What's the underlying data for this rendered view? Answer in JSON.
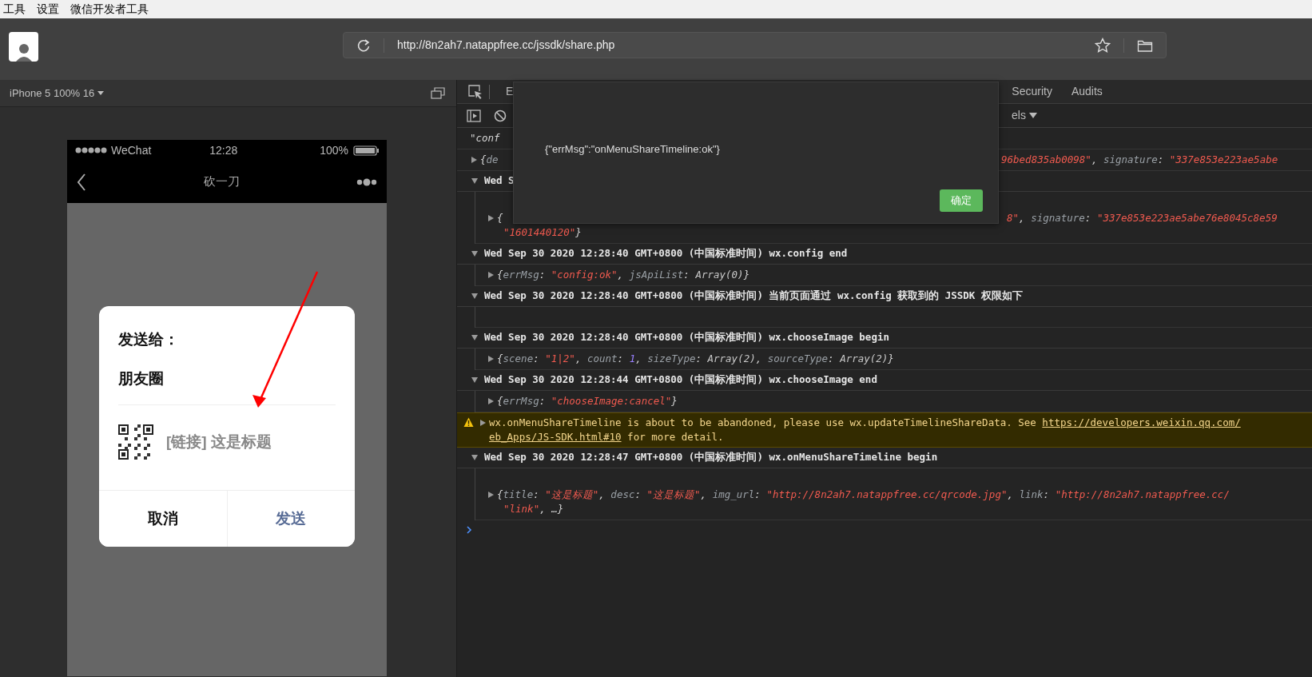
{
  "menu_bar": {
    "items": [
      "工具",
      "设置",
      "微信开发者工具"
    ]
  },
  "toolbar": {
    "url": "http://8n2ah7.natappfree.cc/jssdk/share.php"
  },
  "simulator": {
    "device_label": "iPhone 5 100% 16",
    "status_bar": {
      "carrier": "WeChat",
      "time": "12:28",
      "battery": "100%"
    },
    "nav_bar": {
      "title": "砍一刀"
    },
    "share_dialog": {
      "heading": "发送给：",
      "target": "朋友圈",
      "link_title": "[链接] 这是标题",
      "buttons": [
        {
          "label": "取消",
          "kind": "cancel"
        },
        {
          "label": "发送",
          "kind": "primary"
        }
      ]
    }
  },
  "devtools": {
    "tabs": [
      {
        "label": "E",
        "selected": false
      },
      {
        "label": "Security",
        "selected": false
      },
      {
        "label": "Audits",
        "selected": false
      }
    ],
    "levels_label": "els",
    "console": {
      "rows": [
        {
          "kind": "string",
          "lines": [
            {
              "left": [
                {
                  "kind": "plain",
                  "text": "\"conf"
                }
              ]
            }
          ]
        },
        {
          "kind": "object",
          "expanded": false,
          "lines": [
            {
              "left": [
                {
                  "kind": "plain",
                  "text": "{"
                },
                {
                  "kind": "key",
                  "text": "de"
                }
              ],
              "right": [
                {
                  "kind": "string",
                  "text": "96bed835ab0098\""
                },
                {
                  "kind": "plain",
                  "text": ", "
                },
                {
                  "kind": "key",
                  "text": "signature"
                },
                {
                  "kind": "plain",
                  "text": ": "
                },
                {
                  "kind": "string",
                  "text": "\"337e853e223ae5abe"
                }
              ]
            }
          ]
        },
        {
          "kind": "group",
          "expanded": true,
          "title": "Wed S",
          "children": [
            {
              "kind": "object",
              "expanded": false,
              "lines": [
                {
                  "left": [
                    {
                      "kind": "plain",
                      "text": "{"
                    }
                  ],
                  "right": [
                    {
                      "kind": "string",
                      "text": "8\""
                    },
                    {
                      "kind": "plain",
                      "text": ", "
                    },
                    {
                      "kind": "key",
                      "text": "signature"
                    },
                    {
                      "kind": "plain",
                      "text": ": "
                    },
                    {
                      "kind": "string",
                      "text": "\"337e853e223ae5abe76e8045c8e59"
                    }
                  ]
                },
                {
                  "left": [
                    {
                      "kind": "string",
                      "text": "\"1601440120\""
                    },
                    {
                      "kind": "plain",
                      "text": "}"
                    }
                  ]
                }
              ]
            }
          ]
        },
        {
          "kind": "group",
          "expanded": true,
          "title": "Wed Sep 30 2020 12:28:40 GMT+0800 (中国标准时间) wx.config end",
          "children": [
            {
              "kind": "object",
              "expanded": false,
              "lines": [
                {
                  "left": [
                    {
                      "kind": "plain",
                      "text": "{"
                    },
                    {
                      "kind": "key",
                      "text": "errMsg"
                    },
                    {
                      "kind": "plain",
                      "text": ": "
                    },
                    {
                      "kind": "string",
                      "text": "\"config:ok\""
                    },
                    {
                      "kind": "plain",
                      "text": ", "
                    },
                    {
                      "kind": "key",
                      "text": "jsApiList"
                    },
                    {
                      "kind": "plain",
                      "text": ": "
                    },
                    {
                      "kind": "value",
                      "text": "Array(0)"
                    },
                    {
                      "kind": "plain",
                      "text": "}"
                    }
                  ]
                }
              ]
            }
          ]
        },
        {
          "kind": "group",
          "expanded": true,
          "title": "Wed Sep 30 2020 12:28:40 GMT+0800 (中国标准时间) 当前页面通过 wx.config 获取到的 JSSDK 权限如下",
          "children": [
            {
              "kind": "empty"
            }
          ]
        },
        {
          "kind": "group",
          "expanded": true,
          "title": "Wed Sep 30 2020 12:28:40 GMT+0800 (中国标准时间) wx.chooseImage begin",
          "children": [
            {
              "kind": "object",
              "expanded": false,
              "lines": [
                {
                  "left": [
                    {
                      "kind": "plain",
                      "text": "{"
                    },
                    {
                      "kind": "key",
                      "text": "scene"
                    },
                    {
                      "kind": "plain",
                      "text": ": "
                    },
                    {
                      "kind": "string",
                      "text": "\"1|2\""
                    },
                    {
                      "kind": "plain",
                      "text": ", "
                    },
                    {
                      "kind": "key",
                      "text": "count"
                    },
                    {
                      "kind": "plain",
                      "text": ": "
                    },
                    {
                      "kind": "number",
                      "text": "1"
                    },
                    {
                      "kind": "plain",
                      "text": ", "
                    },
                    {
                      "kind": "key",
                      "text": "sizeType"
                    },
                    {
                      "kind": "plain",
                      "text": ": "
                    },
                    {
                      "kind": "value",
                      "text": "Array(2)"
                    },
                    {
                      "kind": "plain",
                      "text": ", "
                    },
                    {
                      "kind": "key",
                      "text": "sourceType"
                    },
                    {
                      "kind": "plain",
                      "text": ": "
                    },
                    {
                      "kind": "value",
                      "text": "Array(2)"
                    },
                    {
                      "kind": "plain",
                      "text": "}"
                    }
                  ]
                }
              ]
            }
          ]
        },
        {
          "kind": "group",
          "expanded": true,
          "title": "Wed Sep 30 2020 12:28:44 GMT+0800 (中国标准时间) wx.chooseImage end",
          "children": [
            {
              "kind": "object",
              "expanded": false,
              "lines": [
                {
                  "left": [
                    {
                      "kind": "plain",
                      "text": "{"
                    },
                    {
                      "kind": "key",
                      "text": "errMsg"
                    },
                    {
                      "kind": "plain",
                      "text": ": "
                    },
                    {
                      "kind": "string",
                      "text": "\"chooseImage:cancel\""
                    },
                    {
                      "kind": "plain",
                      "text": "}"
                    }
                  ]
                }
              ]
            }
          ]
        },
        {
          "kind": "warning",
          "expanded": false,
          "lines": [
            {
              "left": [
                {
                  "kind": "plain",
                  "text": "wx.onMenuShareTimeline is about to be abandoned, please use wx.updateTimelineShareData. See "
                },
                {
                  "kind": "link",
                  "text": "https://developers.weixin.qq.com/"
                }
              ]
            },
            {
              "left": [
                {
                  "kind": "link",
                  "text": "eb_Apps/JS-SDK.html#10"
                },
                {
                  "kind": "plain",
                  "text": " for more detail."
                }
              ]
            }
          ]
        },
        {
          "kind": "group",
          "expanded": true,
          "title": "Wed Sep 30 2020 12:28:47 GMT+0800 (中国标准时间) wx.onMenuShareTimeline begin",
          "children": [
            {
              "kind": "object",
              "expanded": false,
              "lines": [
                {
                  "left": [
                    {
                      "kind": "plain",
                      "text": "{"
                    },
                    {
                      "kind": "key",
                      "text": "title"
                    },
                    {
                      "kind": "plain",
                      "text": ": "
                    },
                    {
                      "kind": "string",
                      "text": "\"这是标题\""
                    },
                    {
                      "kind": "plain",
                      "text": ", "
                    },
                    {
                      "kind": "key",
                      "text": "desc"
                    },
                    {
                      "kind": "plain",
                      "text": ": "
                    },
                    {
                      "kind": "string",
                      "text": "\"这是标题\""
                    },
                    {
                      "kind": "plain",
                      "text": ", "
                    },
                    {
                      "kind": "key",
                      "text": "img_url"
                    },
                    {
                      "kind": "plain",
                      "text": ": "
                    },
                    {
                      "kind": "string",
                      "text": "\"http://8n2ah7.natappfree.cc/qrcode.jpg\""
                    },
                    {
                      "kind": "plain",
                      "text": ", "
                    },
                    {
                      "kind": "key",
                      "text": "link"
                    },
                    {
                      "kind": "plain",
                      "text": ": "
                    },
                    {
                      "kind": "string",
                      "text": "\"http://8n2ah7.natappfree.cc/"
                    }
                  ]
                },
                {
                  "left": [
                    {
                      "kind": "string",
                      "text": "\"link\""
                    },
                    {
                      "kind": "plain",
                      "text": ", …}"
                    }
                  ]
                }
              ]
            }
          ]
        }
      ]
    },
    "alert": {
      "message": "{\"errMsg\":\"onMenuShareTimeline:ok\"}",
      "button": "确定"
    }
  }
}
